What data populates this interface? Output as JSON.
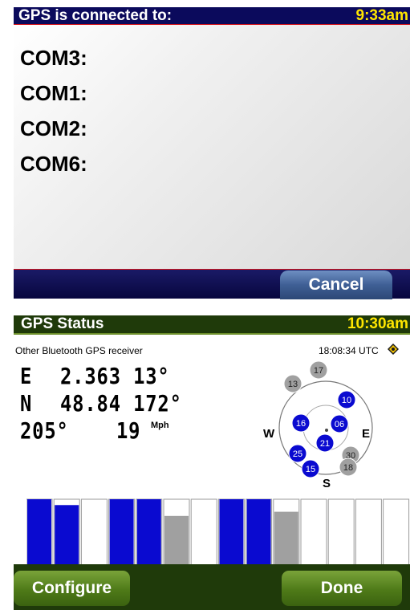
{
  "connect_screen": {
    "title": "GPS is connected to:",
    "time": "9:33am",
    "ports": [
      "COM3:",
      "COM1:",
      "COM2:",
      "COM6:"
    ],
    "cancel_label": "Cancel",
    "colors": {
      "title_bg": "#0b0a5c",
      "accent_line": "#d4141c",
      "time": "#ffe600",
      "button": "#3f5f95"
    }
  },
  "status_screen": {
    "title": "GPS Status",
    "time": "10:30am",
    "receiver": "Other Bluetooth GPS receiver",
    "utc": "18:08:34 UTC",
    "longitude_dir": "E",
    "longitude": "2.363 13°",
    "latitude_dir": "N",
    "latitude": "48.84 172°",
    "heading": "205°",
    "speed": "19",
    "speed_unit": "Mph",
    "compass": {
      "north": "N",
      "east": "E",
      "south": "S",
      "west": "W"
    },
    "satellites_sky": [
      {
        "id": "13",
        "state": "inactive"
      },
      {
        "id": "17",
        "state": "inactive"
      },
      {
        "id": "10",
        "state": "active"
      },
      {
        "id": "16",
        "state": "active"
      },
      {
        "id": "06",
        "state": "active"
      },
      {
        "id": "21",
        "state": "active"
      },
      {
        "id": "25",
        "state": "active"
      },
      {
        "id": "15",
        "state": "active"
      },
      {
        "id": "30",
        "state": "inactive"
      },
      {
        "id": "18",
        "state": "inactive"
      }
    ],
    "signal_bars": [
      {
        "id": "06",
        "level": 1.0,
        "state": "active"
      },
      {
        "id": "10",
        "level": 0.93,
        "state": "active"
      },
      {
        "id": "13",
        "level": 0,
        "state": "none"
      },
      {
        "id": "15",
        "level": 1.0,
        "state": "active"
      },
      {
        "id": "16",
        "level": 1.0,
        "state": "active"
      },
      {
        "id": "17",
        "level": 0.8,
        "state": "inactive"
      },
      {
        "id": "18",
        "level": 0,
        "state": "none"
      },
      {
        "id": "21",
        "level": 1.0,
        "state": "active"
      },
      {
        "id": "25",
        "level": 1.0,
        "state": "active"
      },
      {
        "id": "30",
        "level": 0.85,
        "state": "inactive"
      },
      {
        "id": "",
        "level": 0,
        "state": "empty"
      },
      {
        "id": "",
        "level": 0,
        "state": "empty"
      },
      {
        "id": "",
        "level": 0,
        "state": "empty"
      },
      {
        "id": "",
        "level": 0,
        "state": "empty"
      }
    ],
    "configure_label": "Configure",
    "done_label": "Done",
    "colors": {
      "title_bg": "#1f3a0a",
      "active_sat": "#0a0ad0",
      "inactive_sat": "#a0a0a0",
      "button": "#4e7a18"
    }
  }
}
